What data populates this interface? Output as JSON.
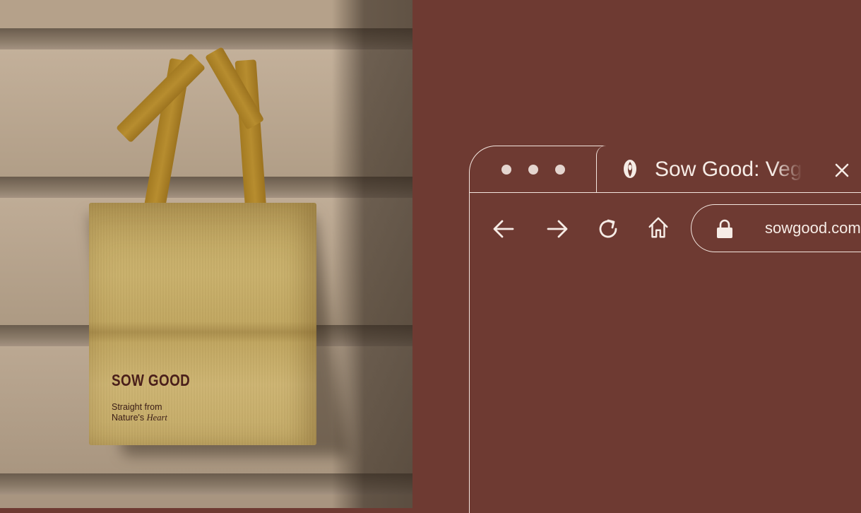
{
  "photo": {
    "bag_logo": "SOW GOOD",
    "bag_tagline_line1": "Straight from",
    "bag_tagline_line2_prefix": "Nature's ",
    "bag_tagline_line2_italic": "Heart"
  },
  "browser": {
    "tab": {
      "title": "Sow Good: Vegan",
      "icon": "seed-logo-icon",
      "close_icon": "close-icon"
    },
    "nav": {
      "back_icon": "arrow-left-icon",
      "forward_icon": "arrow-right-icon",
      "reload_icon": "reload-icon",
      "home_icon": "home-icon"
    },
    "address_bar": {
      "lock_icon": "lock-icon",
      "url": "sowgood.com"
    }
  },
  "colors": {
    "background": "#6e3a32",
    "outline": "#f3e6df",
    "bag": "#c4aa64",
    "logo_ink": "#4a1f1a"
  }
}
